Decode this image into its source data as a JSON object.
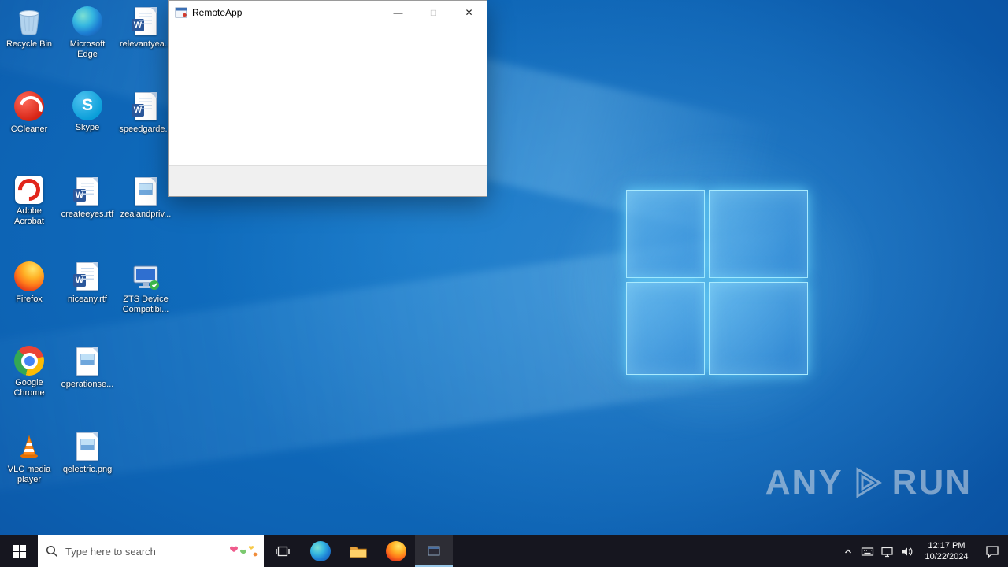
{
  "window": {
    "title": "RemoteApp",
    "controls": {
      "minimize": "—",
      "maximize": "□",
      "close": "✕"
    }
  },
  "desktop": {
    "icons": [
      {
        "label": "Recycle Bin",
        "type": "recycle-bin"
      },
      {
        "label": "CCleaner",
        "type": "ccleaner"
      },
      {
        "label": "Adobe Acrobat",
        "type": "acrobat"
      },
      {
        "label": "Firefox",
        "type": "firefox"
      },
      {
        "label": "Google Chrome",
        "type": "chrome"
      },
      {
        "label": "VLC media player",
        "type": "vlc"
      },
      {
        "label": "Microsoft Edge",
        "type": "edge"
      },
      {
        "label": "Skype",
        "type": "skype"
      },
      {
        "label": "createeyes.rtf",
        "type": "word-doc"
      },
      {
        "label": "niceany.rtf",
        "type": "word-doc"
      },
      {
        "label": "operationse...",
        "type": "image-file"
      },
      {
        "label": "qelectric.png",
        "type": "image-file"
      },
      {
        "label": "relevantyea...",
        "type": "word-doc"
      },
      {
        "label": "speedgarde...",
        "type": "word-doc"
      },
      {
        "label": "zealandpriv...",
        "type": "image-file"
      },
      {
        "label": "ZTS Device Compatibi...",
        "type": "device-tool"
      }
    ]
  },
  "taskbar": {
    "search_placeholder": "Type here to search",
    "clock": {
      "time": "12:17 PM",
      "date": "10/22/2024"
    }
  },
  "watermark": {
    "left": "ANY",
    "right": "RUN"
  },
  "colors": {
    "taskbar_bg": "#16161f",
    "wallpaper_blue": "#0d63b4",
    "logo_glow": "#7fd9ff"
  }
}
